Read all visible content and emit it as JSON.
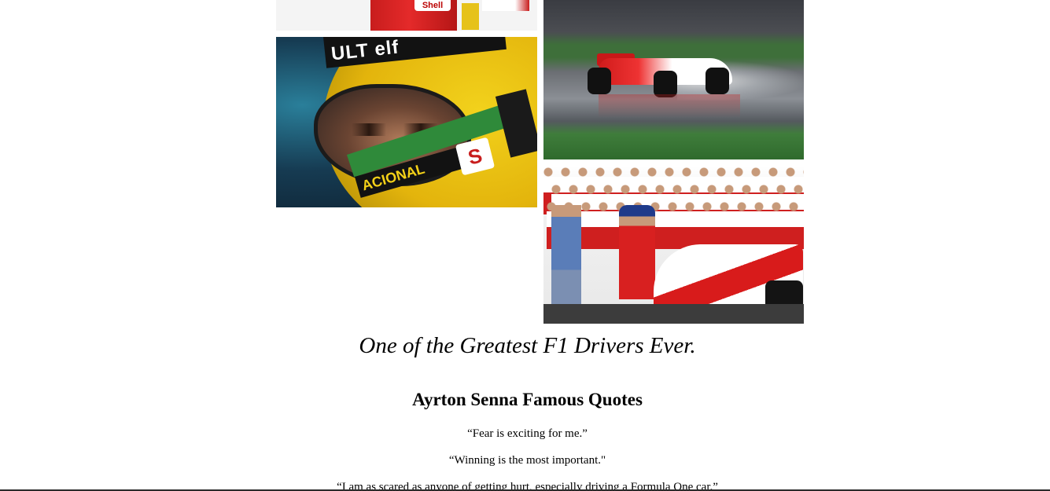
{
  "gallery": {
    "images": [
      {
        "name": "podium-photo",
        "visible_text": "Shell"
      },
      {
        "name": "helmet-closeup-photo",
        "visible_text": "ULT elf",
        "helmet_lower_text": "ACIONAL",
        "logo_text": "S"
      },
      {
        "name": "wet-track-car-photo"
      },
      {
        "name": "team-photo"
      }
    ]
  },
  "main": {
    "tagline": "One of the Greatest F1 Drivers Ever.",
    "quotes_heading": "Ayrton Senna Famous Quotes",
    "quotes": [
      "“Fear is exciting for me.”",
      "“Winning is the most important.\"",
      "“I am as scared as anyone of getting hurt, especially driving a Formula One car.”"
    ]
  },
  "colors": {
    "background": "#ffffff",
    "text": "#000000",
    "mclaren_red": "#d01b1b",
    "helmet_yellow": "#f2d21c"
  }
}
